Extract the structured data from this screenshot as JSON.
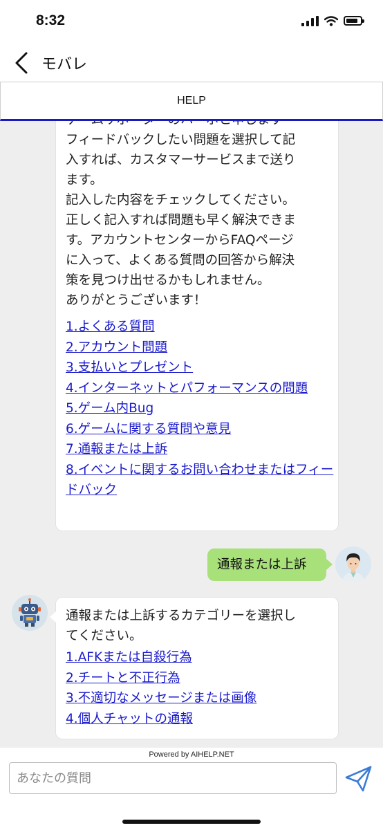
{
  "status_bar": {
    "time": "8:32"
  },
  "nav": {
    "title": "モバレ"
  },
  "help_header": {
    "title": "HELP"
  },
  "bot_message_1": {
    "text_lines": [
      "ゲームサポーターのハーボと申します",
      "フィードバックしたい問題を選択して記",
      "入すれば、カスタマーサービスまで送り",
      "ます。",
      "記入した内容をチェックしてください。",
      "正しく記入すれば問題も早く解決できま",
      "す。アカウントセンターからFAQページ",
      "に入って、よくある質問の回答から解決",
      "策を見つけ出せるかもしれません。",
      "ありがとうございます！"
    ],
    "links": [
      {
        "label": "1.よくある質問"
      },
      {
        "label": "2.アカウント問題"
      },
      {
        "label": "3.支払いとプレゼント"
      },
      {
        "label": "4.インターネットとパフォーマンスの問題"
      },
      {
        "label": "5.ゲーム内Bug"
      },
      {
        "label": "6.ゲームに関する質問や意見"
      },
      {
        "label": "7.通報または上訴"
      },
      {
        "label": "8.イベントに関するお問い合わせまたはフィードバック"
      }
    ]
  },
  "user_message": {
    "text": "通報または上訴"
  },
  "bot_message_2": {
    "text_lines": [
      "通報または上訴するカテゴリーを選択し",
      "てください。"
    ],
    "links": [
      {
        "label": "1.AFKまたは自殺行為"
      },
      {
        "label": "2.チートと不正行為"
      },
      {
        "label": "3.不適切なメッセージまたは画像"
      },
      {
        "label": "4.個人チャットの通報"
      }
    ]
  },
  "footer": {
    "powered_by": "Powered by AIHELP.NET",
    "input_placeholder": "あなたの質問"
  },
  "colors": {
    "link": "#1a1acc",
    "user_bubble": "#a8e07a",
    "header_underline": "#1a1ac2",
    "chat_background": "#eeeeee",
    "send_icon": "#3a7bd5"
  }
}
